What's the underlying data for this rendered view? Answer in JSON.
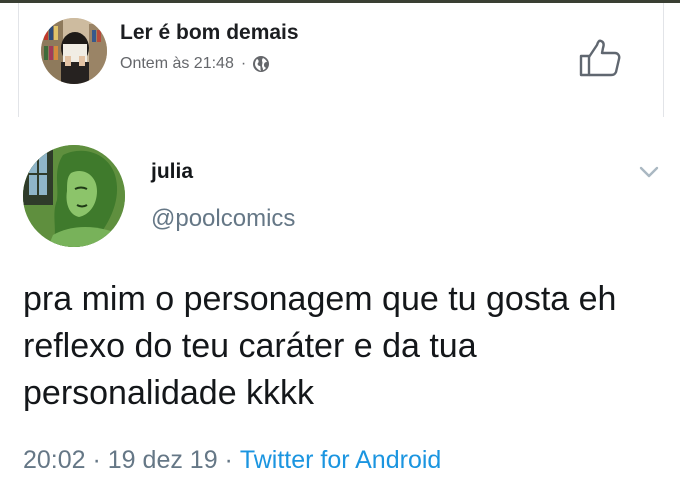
{
  "post": {
    "page_name": "Ler é bom demais",
    "timestamp": "Ontem às 21:48",
    "separator": "·",
    "privacy_icon": "globe-icon",
    "action_icon": "thumbs-up-icon"
  },
  "tweet": {
    "display_name": "julia",
    "handle": "@poolcomics",
    "text": "pra mim o personagem que tu gosta eh reflexo do teu caráter e da tua personalidade kkkk",
    "time": "20:02",
    "date": "19 dez 19",
    "source": "Twitter for Android",
    "separator": " · ",
    "menu_icon": "chevron-down-icon",
    "colors": {
      "link": "#1b95e0",
      "secondary": "#657786"
    }
  }
}
